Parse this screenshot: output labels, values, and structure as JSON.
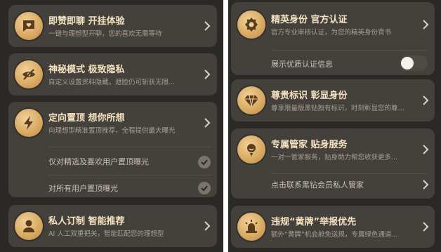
{
  "left_panel": {
    "cards": [
      {
        "title": "即赞即聊  开挂体验",
        "subtitle": "一键与理想型开聊，您的喜欢无需等待",
        "icon": "chat-heart-icon"
      },
      {
        "title": "神秘模式  极致隐私",
        "subtitle": "自定义设置资料隐藏，遮脸仍可斩获无限...",
        "icon": "eye-hidden-icon"
      },
      {
        "title": "定向置顶  想你所想",
        "subtitle": "向理想型精准置顶推荐，全程提供最大曝光",
        "icon": "lightning-icon",
        "options": [
          {
            "label": "仅对精选及喜欢用户置顶曝光",
            "checked": true
          },
          {
            "label": "对所有用户置顶曝光",
            "checked": true
          }
        ]
      },
      {
        "title": "私人订制  智能推荐",
        "subtitle": "AI 人工双重把关，智能匹配您的理想型",
        "icon": "person-icon"
      }
    ]
  },
  "right_panel": {
    "cards": [
      {
        "title": "精英身份  官方认证",
        "subtitle": "官方专业审核认证，为您的精英身份背书",
        "icon": "badge-star-icon",
        "toggle": {
          "label": "展示优质认证信息",
          "on": false
        }
      },
      {
        "title": "尊贵标识  彰显身份",
        "subtitle": "尊享限量版黑钻独有标识，时刻彰显您的尊...",
        "icon": "diamond-icon"
      },
      {
        "title": "专属管家  贴身服务",
        "subtitle": "一对一管家服务，贴身助力帮您收获更多...",
        "icon": "butler-icon",
        "link": {
          "label": "点击联系黑钻会员私人管家"
        }
      },
      {
        "title": "违规“黄牌”举报优先",
        "subtitle": "额外“黄牌”机会舱免送规，专属绿色通道...",
        "icon": "alarm-icon"
      }
    ]
  },
  "colors": {
    "panel": "#2b2926",
    "card": "#44413c",
    "gold": "#d9ab63",
    "title": "#f5e2c0",
    "subtitle": "#a89f92"
  }
}
